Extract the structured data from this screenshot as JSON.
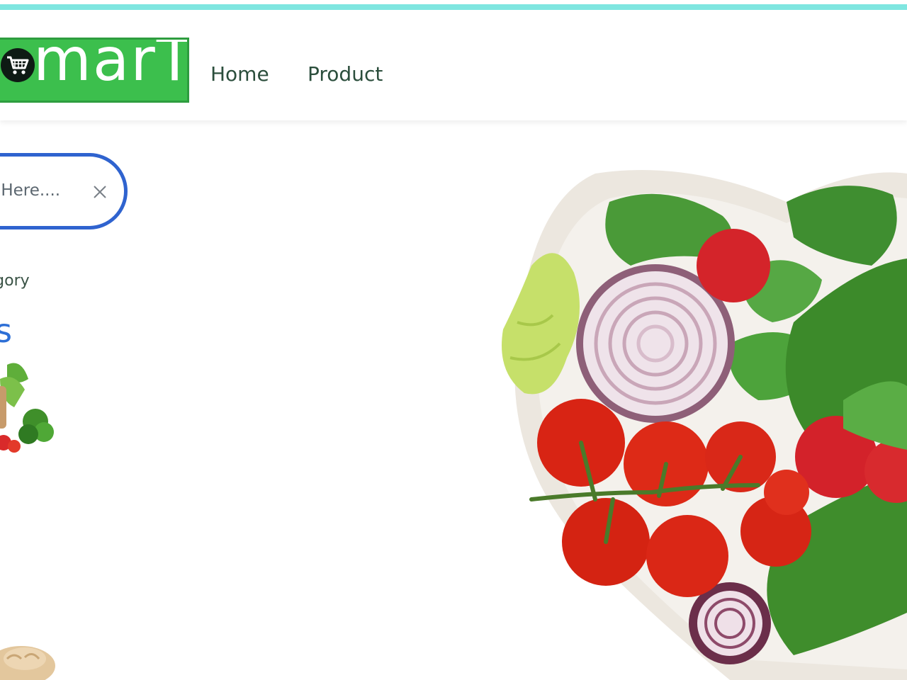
{
  "brand": {
    "logo_text": "marT",
    "logo_icon": "shopping-cart-icon",
    "logo_bg": "#3cbf4d",
    "logo_border": "#2e9d3f"
  },
  "nav": {
    "items": [
      {
        "label": "Home"
      },
      {
        "label": "Product"
      }
    ],
    "link_color": "#2b4e3c"
  },
  "search": {
    "placeholder": "t Here....",
    "clear_icon": "close-icon",
    "border_color": "#2f63cf"
  },
  "category": {
    "label": "tegory",
    "name": "les",
    "name_color": "#2d6fd6"
  },
  "accent": {
    "top_strip": "#7fe6e0"
  },
  "hero": {
    "image": "heart-bowl-vegetables"
  }
}
